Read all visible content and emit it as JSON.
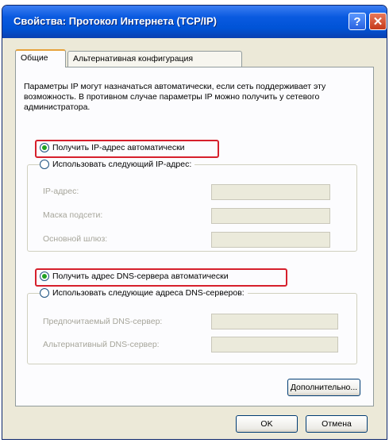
{
  "window": {
    "title": "Свойства: Протокол Интернета (TCP/IP)",
    "help_glyph": "?",
    "close_glyph": "✕"
  },
  "tabs": [
    {
      "label": "Общие",
      "active": true
    },
    {
      "label": "Альтернативная конфигурация",
      "active": false
    }
  ],
  "general": {
    "description": "Параметры IP могут назначаться автоматически, если сеть поддерживает эту возможность. В противном случае параметры IP можно получить у сетевого администратора.",
    "ip_auto": {
      "label": "Получить IP-адрес автоматически",
      "selected": true
    },
    "ip_manual": {
      "label": "Использовать следующий IP-адрес:",
      "selected": false,
      "fields": [
        {
          "label": "IP-адрес:",
          "value": ""
        },
        {
          "label": "Маска подсети:",
          "value": ""
        },
        {
          "label": "Основной шлюз:",
          "value": ""
        }
      ]
    },
    "dns_auto": {
      "label": "Получить адрес DNS-сервера автоматически",
      "selected": true
    },
    "dns_manual": {
      "label": "Использовать следующие адреса DNS-серверов:",
      "selected": false,
      "fields": [
        {
          "label": "Предпочитаемый DNS-сервер:",
          "value": ""
        },
        {
          "label": "Альтернативный DNS-сервер:",
          "value": ""
        }
      ]
    },
    "advanced_button": "Дополнительно..."
  },
  "footer": {
    "ok_button": "OK",
    "cancel_button": "Отмена"
  },
  "colors": {
    "titlebar": "#0053d6",
    "highlight_outline": "#d6202c",
    "dialog_bg": "#ece9d8"
  }
}
